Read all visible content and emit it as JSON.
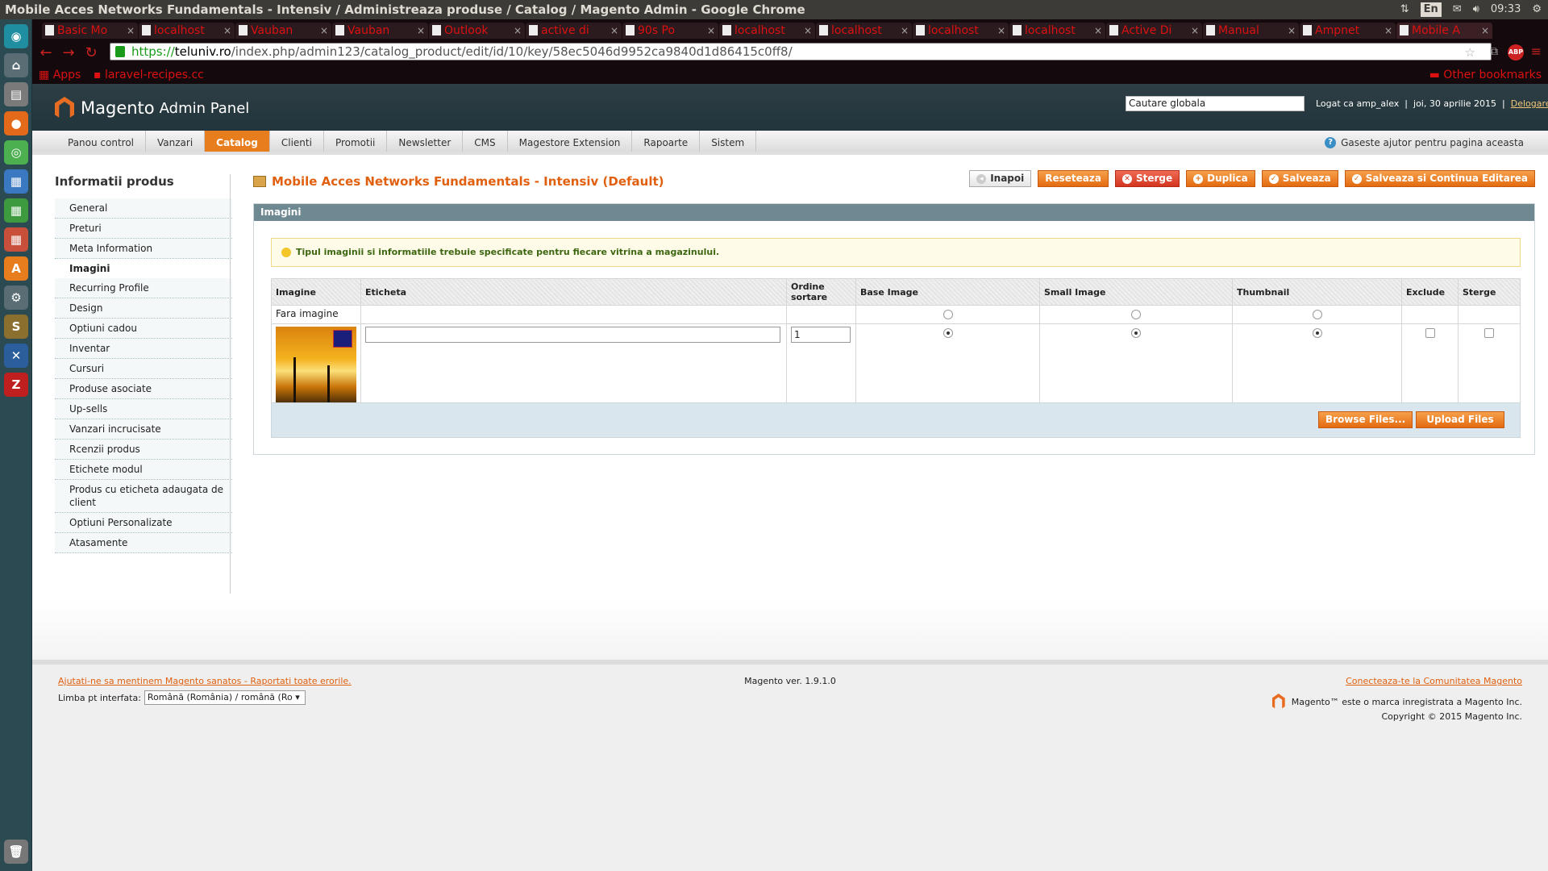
{
  "window_title": "Mobile Acces Networks Fundamentals - Intensiv / Administreaza produse / Catalog / Magento Admin - Google Chrome",
  "tray": {
    "lang": "En",
    "time": "09:33"
  },
  "tabs": [
    {
      "label": "Basic Mo"
    },
    {
      "label": "localhost"
    },
    {
      "label": "Vauban"
    },
    {
      "label": "Vauban"
    },
    {
      "label": "Outlook"
    },
    {
      "label": "active di"
    },
    {
      "label": "90s Po"
    },
    {
      "label": "localhost"
    },
    {
      "label": "localhost"
    },
    {
      "label": "localhost"
    },
    {
      "label": "localhost"
    },
    {
      "label": "Active Di"
    },
    {
      "label": "Manual"
    },
    {
      "label": "Ampnet"
    },
    {
      "label": "Mobile A"
    }
  ],
  "browser": {
    "url_scheme": "https://",
    "url_host": "teluniv.ro",
    "url_path": "/index.php/admin123/catalog_product/edit/id/10/key/58ec5046d9952ca9840d1d86415c0ff8/",
    "bookmarks": {
      "apps": "Apps",
      "item1": "laravel-recipes.cc",
      "other": "Other bookmarks"
    }
  },
  "header": {
    "logo_main": "Magento",
    "logo_sub": "Admin Panel",
    "search_value": "Cautare globala",
    "logged_as": "Logat ca amp_alex",
    "date": "joi, 30 aprilie 2015",
    "logout": "Delogare"
  },
  "nav": {
    "items": [
      "Panou control",
      "Vanzari",
      "Catalog",
      "Clienti",
      "Promotii",
      "Newsletter",
      "CMS",
      "Magestore Extension",
      "Rapoarte",
      "Sistem"
    ],
    "active": "Catalog",
    "help": "Gaseste ajutor pentru pagina aceasta"
  },
  "sidebar": {
    "title": "Informatii produs",
    "items": [
      "General",
      "Preturi",
      "Meta Information",
      "Imagini",
      "Recurring Profile",
      "Design",
      "Optiuni cadou",
      "Inventar",
      "Cursuri",
      "Produse asociate",
      "Up-sells",
      "Vanzari incrucisate",
      "Rcenzii produs",
      "Etichete modul",
      "Produs cu eticheta adaugata de client",
      "Optiuni Personalizate",
      "Atasamente"
    ],
    "active": "Imagini"
  },
  "page": {
    "title": "Mobile Acces Networks Fundamentals - Intensiv (Default)",
    "buttons": {
      "back": "Inapoi",
      "reset": "Reseteaza",
      "delete": "Sterge",
      "duplicate": "Duplica",
      "save": "Salveaza",
      "save_continue": "Salveaza si Continua Editarea"
    }
  },
  "images": {
    "section_title": "Imagini",
    "notice": "Tipul imaginii si informatiile trebuie specificate pentru fiecare vitrina a magazinului.",
    "columns": [
      "Imagine",
      "Eticheta",
      "Ordine sortare",
      "Base Image",
      "Small Image",
      "Thumbnail",
      "Exclude",
      "Sterge"
    ],
    "no_image_label": "Fara imagine",
    "row": {
      "label_value": "",
      "sort_order": "1",
      "base": true,
      "small": true,
      "thumbnail": true,
      "exclude": false,
      "delete": false
    },
    "browse_button": "Browse Files...",
    "upload_button": "Upload Files"
  },
  "footer": {
    "help_link": "Ajutati-ne sa mentinem Magento sanatos - Raportati toate erorile.",
    "lang_label": "Limba pt interfata:",
    "lang_value": "Română (România) / română (Ro",
    "version": "Magento ver. 1.9.1.0",
    "community": "Conecteaza-te la Comunitatea Magento",
    "trademark": "Magento™ este o marca inregistrata a Magento Inc.",
    "copyright": "Copyright © 2015 Magento Inc."
  }
}
